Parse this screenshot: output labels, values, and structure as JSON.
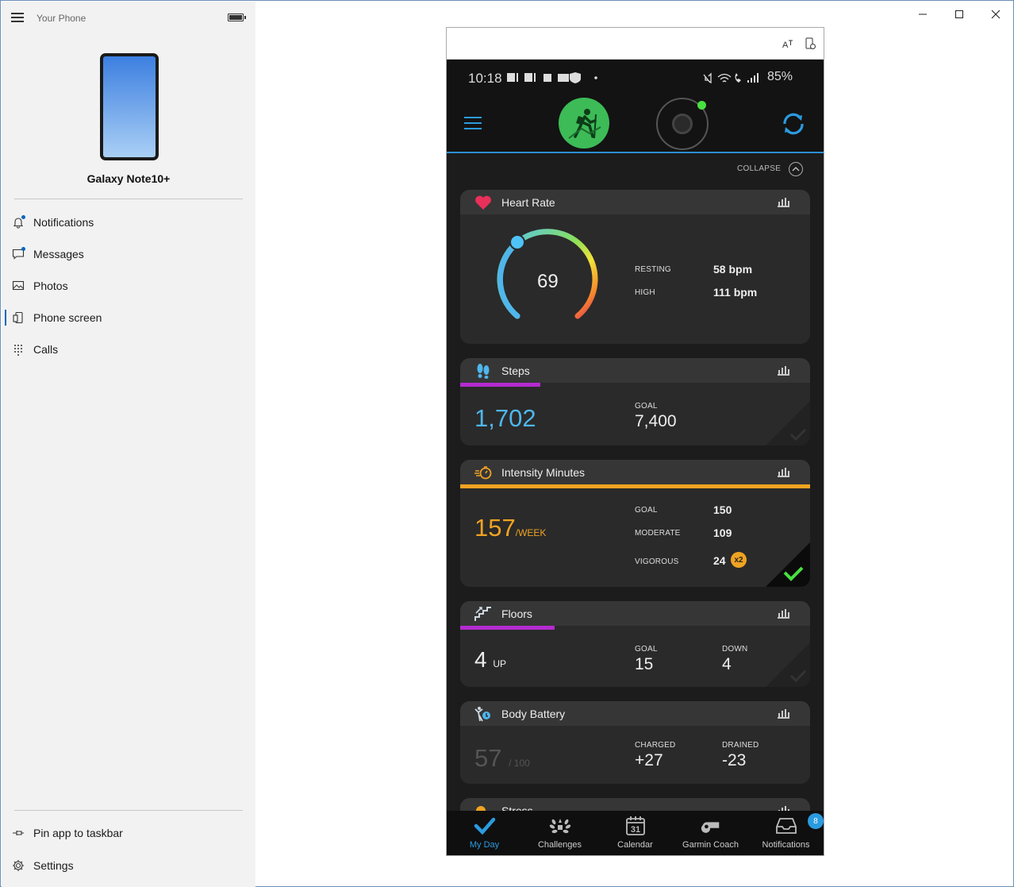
{
  "window": {
    "app_title": "Your Phone",
    "controls": {
      "minimize": "—",
      "maximize": "☐",
      "close": "✕"
    }
  },
  "sidebar": {
    "device_name": "Galaxy Note10+",
    "nav": [
      {
        "label": "Notifications",
        "icon": "bell-icon",
        "active": false
      },
      {
        "label": "Messages",
        "icon": "message-icon",
        "active": false
      },
      {
        "label": "Photos",
        "icon": "photos-icon",
        "active": false
      },
      {
        "label": "Phone screen",
        "icon": "phone-screen-icon",
        "active": true
      },
      {
        "label": "Calls",
        "icon": "dialpad-icon",
        "active": false
      }
    ],
    "bottom": [
      {
        "label": "Pin app to taskbar",
        "icon": "pin-icon"
      },
      {
        "label": "Settings",
        "icon": "gear-icon"
      }
    ]
  },
  "phone": {
    "status": {
      "time": "10:18",
      "battery": "85%"
    },
    "collapse_label": "COLLAPSE",
    "cards": {
      "heart_rate": {
        "title": "Heart Rate",
        "value": "69",
        "resting_label": "RESTING",
        "resting_value": "58 bpm",
        "high_label": "HIGH",
        "high_value": "111 bpm"
      },
      "steps": {
        "title": "Steps",
        "value": "1,702",
        "goal_label": "GOAL",
        "goal_value": "7,400",
        "progress": 0.23,
        "color": "#b42bd0"
      },
      "intensity": {
        "title": "Intensity Minutes",
        "value": "157",
        "unit": "/WEEK",
        "goal_label": "GOAL",
        "goal_value": "150",
        "moderate_label": "MODERATE",
        "moderate_value": "109",
        "vigorous_label": "VIGOROUS",
        "vigorous_value": "24",
        "multiplier": "x2",
        "progress": 1.0,
        "color": "#f0a322"
      },
      "floors": {
        "title": "Floors",
        "value": "4",
        "unit": "UP",
        "goal_label": "GOAL",
        "goal_value": "15",
        "down_label": "DOWN",
        "down_value": "4",
        "progress": 0.27,
        "color": "#b42bd0"
      },
      "body_battery": {
        "title": "Body Battery",
        "value": "57",
        "unit": "/ 100",
        "charged_label": "CHARGED",
        "charged_value": "+27",
        "drained_label": "DRAINED",
        "drained_value": "-23"
      },
      "stress": {
        "title": "Stress"
      }
    },
    "bottom_nav": [
      {
        "label": "My Day",
        "icon": "checkmark-icon",
        "active": true
      },
      {
        "label": "Challenges",
        "icon": "laurel-icon",
        "active": false
      },
      {
        "label": "Calendar",
        "icon": "calendar-icon",
        "active": false,
        "day": "31"
      },
      {
        "label": "Garmin Coach",
        "icon": "whistle-icon",
        "active": false
      },
      {
        "label": "Notifications",
        "icon": "inbox-icon",
        "active": false,
        "badge": "8"
      }
    ]
  }
}
